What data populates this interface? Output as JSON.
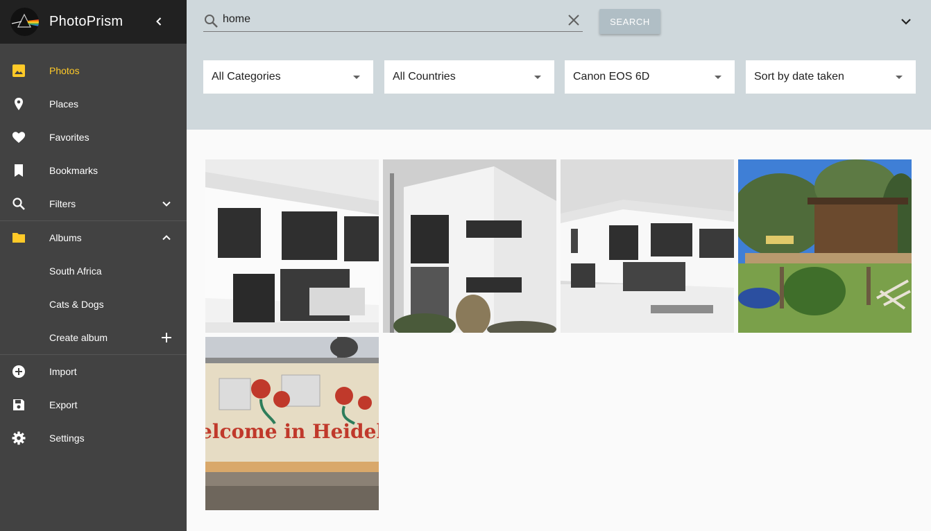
{
  "app": {
    "title": "PhotoPrism"
  },
  "sidebar": {
    "items": [
      {
        "label": "Photos",
        "icon": "photo-icon",
        "active": true
      },
      {
        "label": "Places",
        "icon": "place-pin-icon"
      },
      {
        "label": "Favorites",
        "icon": "heart-icon"
      },
      {
        "label": "Bookmarks",
        "icon": "bookmark-icon"
      },
      {
        "label": "Filters",
        "icon": "search-icon",
        "trailing": "chevron-down-icon"
      },
      {
        "label": "Albums",
        "icon": "folder-icon",
        "trailing": "chevron-up-icon"
      },
      {
        "label": "South Africa"
      },
      {
        "label": "Cats & Dogs"
      },
      {
        "label": "Create album",
        "trailing": "plus-icon"
      },
      {
        "label": "Import",
        "icon": "add-circle-icon"
      },
      {
        "label": "Export",
        "icon": "save-icon"
      },
      {
        "label": "Settings",
        "icon": "gear-icon"
      }
    ]
  },
  "search": {
    "value": "home",
    "button_label": "SEARCH"
  },
  "filters": {
    "category": "All Categories",
    "country": "All Countries",
    "camera": "Canon EOS 6D",
    "sort": "Sort by date taken"
  },
  "photos": [
    {
      "alt": "White modern house in snow"
    },
    {
      "alt": "White house corner with windows"
    },
    {
      "alt": "White modern house, snowy yard"
    },
    {
      "alt": "Wooden cabin deck with trees"
    },
    {
      "alt": "Mural wall with flowers",
      "text": "elcome in Heidelbe"
    }
  ],
  "colors": {
    "accent": "#ffca28",
    "sidebar_bg": "#424242",
    "brand_bg": "#212121",
    "toolbar_bg": "#cfd8dc"
  }
}
